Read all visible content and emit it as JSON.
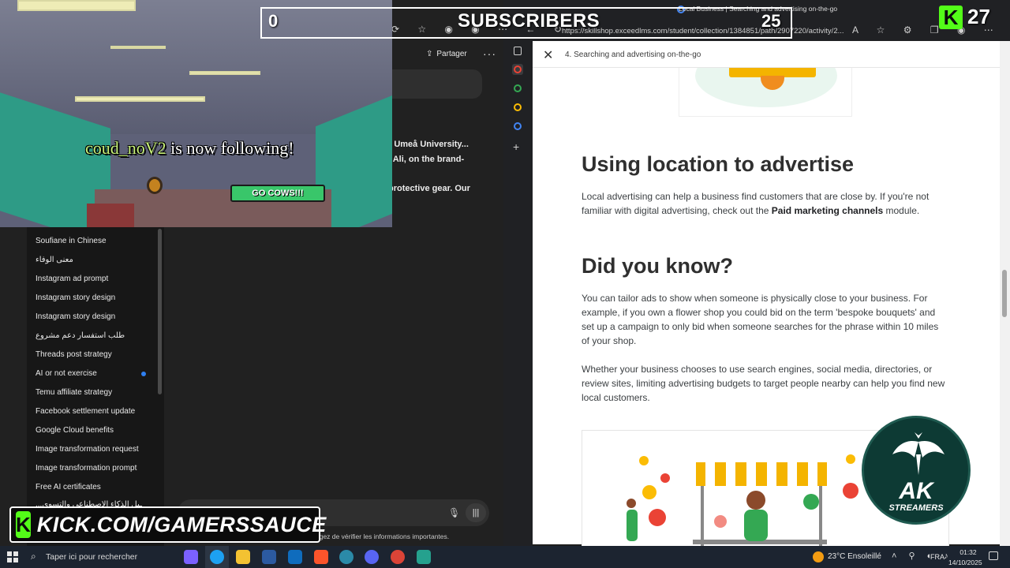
{
  "overlay": {
    "subscribers_current": "0",
    "subscribers_label": "SUBSCRIBERS",
    "subscribers_goal": "25",
    "kick_count": "27",
    "kick_url": "KICK.COM/GAMERSSAUCE",
    "follow_name": "coud_noV2",
    "follow_suffix": " is now following!",
    "banner_text": "GO COWS!!!",
    "logo_main": "AK",
    "logo_sub": "STREAMERS",
    "colors": {
      "kick_green": "#53fc18"
    }
  },
  "chat_app": {
    "share_label": "Partager",
    "more_label": "···",
    "message_lines": [
      "r Umeå University...",
      ", Ali, on the brand-",
      "protective gear. Our"
    ],
    "sidebar_items": [
      "Soufiane in Chinese",
      "معنى الوفاء",
      "Instagram ad prompt",
      "Instagram story design",
      "Instagram story design",
      "طلب استفسار دعم مشروع",
      "Threads post strategy",
      "AI or not exercise",
      "Temu affiliate strategy",
      "Facebook settlement update",
      "Google Cloud benefits",
      "Image transformation request",
      "Image transformation prompt",
      "Free AI certificates",
      "...ـيل الذكاء الاصطناعي والتسوي"
    ],
    "disclaimer": "agez de vérifier les informations importantes."
  },
  "browser": {
    "tab_title": "Local Business | Searching and advertising on-the-go",
    "url": "https://skillshop.exceedlms.com/student/collection/1384851/path/2907220/activity/2...",
    "doc_title": "4. Searching and advertising on-the-go",
    "section1_heading": "Using location to advertise",
    "section1_text_a": "Local advertising can help a business find customers that are close by. If you're not familiar with digital advertising, check out the ",
    "section1_link": "Paid marketing channels",
    "section1_text_b": " module.",
    "section2_heading": "Did you know?",
    "section2_para1": "You can tailor ads to show when someone is physically close to your business. For example, if you own a flower shop you could bid on the term 'bespoke bouquets' and set up a campaign to only bid when someone searches for the phrase within 10 miles of your shop.",
    "section2_para2": "Whether your business chooses to use search engines, social media, directories, or review sites, limiting advertising budgets to target people nearby can help you find new local customers."
  },
  "taskbar": {
    "search_placeholder": "Taper ici pour rechercher",
    "weather": "23°C  Ensoleillé",
    "language": "FRA",
    "time": "01:32",
    "date": "14/10/2025"
  }
}
